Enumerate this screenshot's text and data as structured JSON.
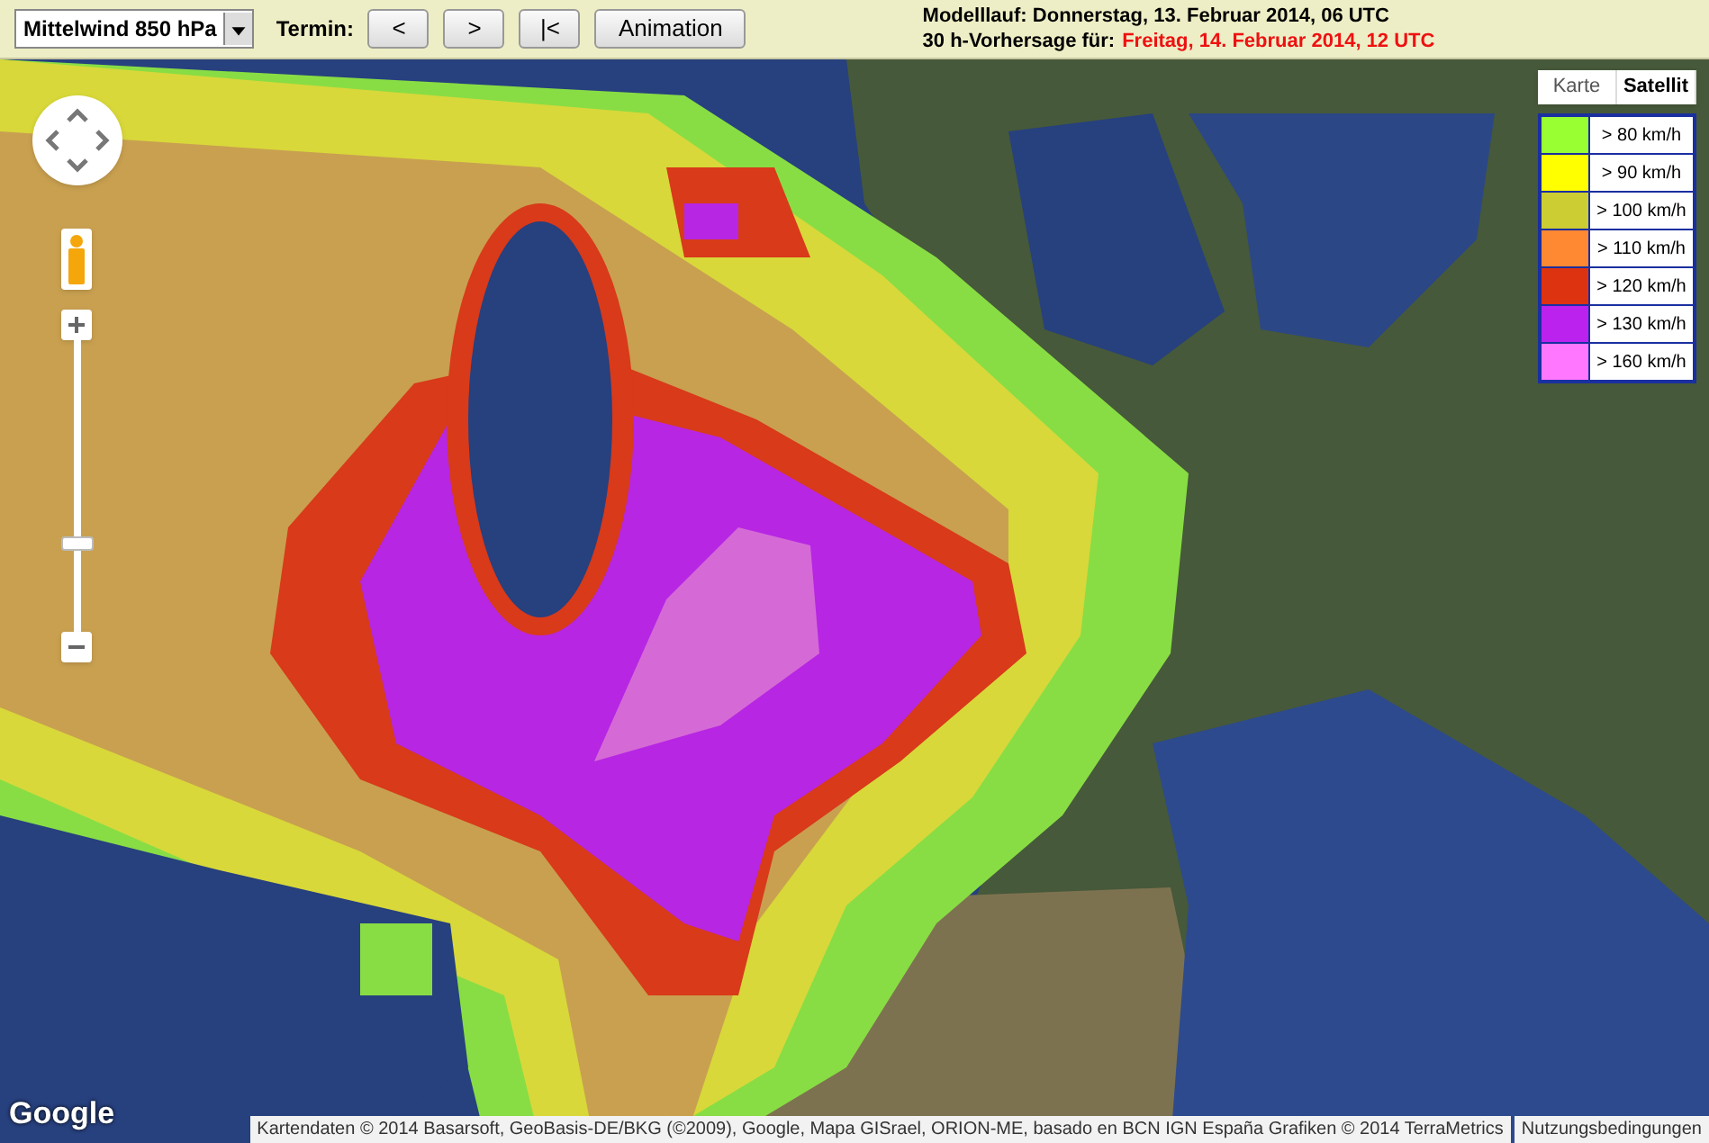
{
  "toolbar": {
    "product_select": {
      "value": "Mittelwind 850 hPa"
    },
    "termin_label": "Termin:",
    "buttons": [
      "<",
      ">",
      "|<",
      "Animation"
    ],
    "model_run": "Modelllauf: Donnerstag, 13. Februar 2014, 06 UTC",
    "forecast_label": "30 h-Vorhersage für:",
    "forecast_time": "Freitag, 14. Februar 2014, 12 UTC"
  },
  "map": {
    "map_types": [
      {
        "label": "Karte",
        "selected": false
      },
      {
        "label": "Satellit",
        "selected": true
      }
    ],
    "zoom": {
      "level": 0.3
    },
    "legend": [
      {
        "label": "> 80 km/h",
        "color": "#99ff33"
      },
      {
        "label": "> 90 km/h",
        "color": "#ffff00"
      },
      {
        "label": "> 100 km/h",
        "color": "#cccc33"
      },
      {
        "label": "> 110 km/h",
        "color": "#ff8833"
      },
      {
        "label": "> 120 km/h",
        "color": "#dd3311"
      },
      {
        "label": "> 130 km/h",
        "color": "#bb22ee"
      },
      {
        "label": "> 160 km/h",
        "color": "#ff77ff"
      }
    ],
    "logo": "Google",
    "attribution": "Kartendaten © 2014 Basarsoft, GeoBasis-DE/BKG (©2009), Google, Mapa GISrael, ORION-ME, basado en BCN IGN España Grafiken © 2014 TerraMetrics",
    "terms_link": "Nutzungsbedingungen"
  }
}
